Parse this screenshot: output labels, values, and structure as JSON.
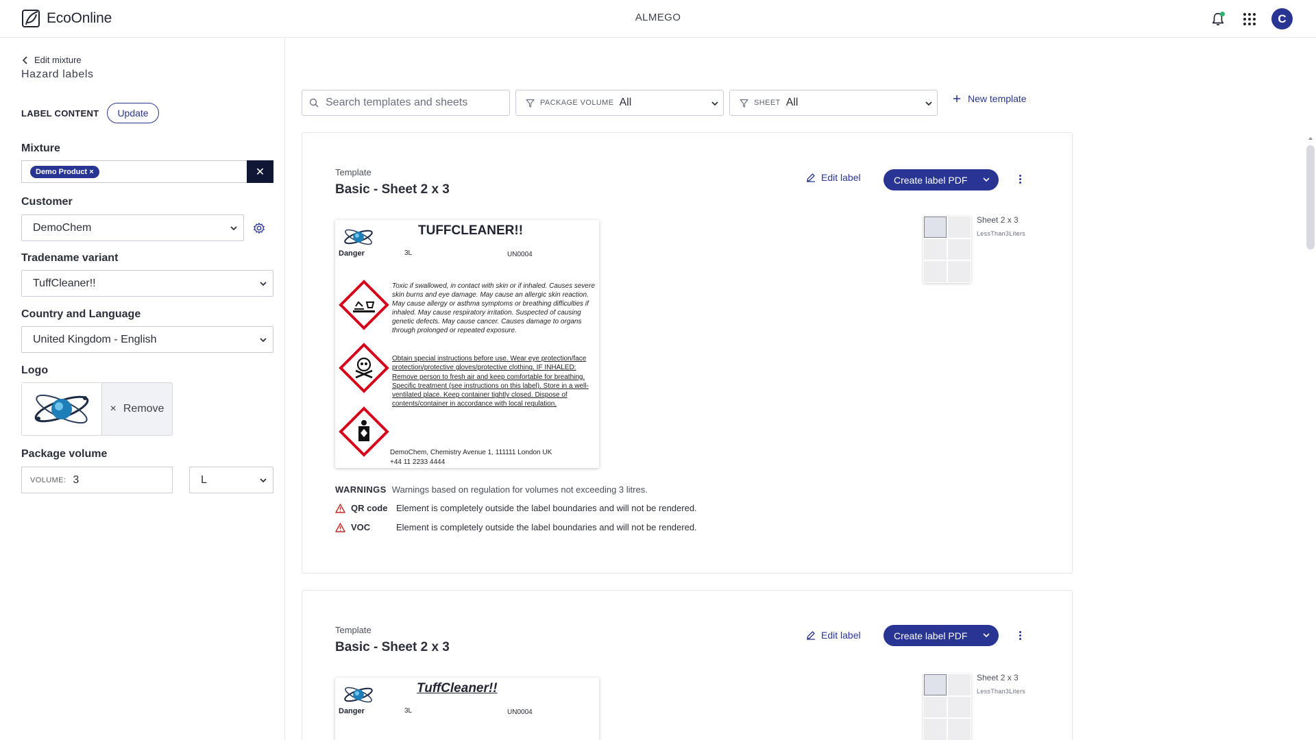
{
  "app": {
    "brand": "EcoOnline",
    "org": "ALMEGO",
    "avatar_initial": "C"
  },
  "left": {
    "back_link": "Edit mixture",
    "page_title": "Hazard labels",
    "label_content": "LABEL CONTENT",
    "update_button": "Update",
    "mixture": {
      "label": "Mixture",
      "chip": "Demo Product ×",
      "clear": "✕"
    },
    "customer": {
      "label": "Customer",
      "value": "DemoChem"
    },
    "tradename": {
      "label": "Tradename variant",
      "value": "TuffCleaner!!"
    },
    "country": {
      "label": "Country and Language",
      "value": "United Kingdom - English"
    },
    "logo": {
      "label": "Logo",
      "remove": "Remove",
      "remove_icon": "×"
    },
    "package": {
      "label": "Package volume",
      "prefix": "VOLUME:",
      "value": "3",
      "unit": "L"
    }
  },
  "toolbar": {
    "search_placeholder": "Search templates and sheets",
    "package_filter": {
      "key": "PACKAGE VOLUME",
      "value": "All"
    },
    "sheet_filter": {
      "key": "SHEET",
      "value": "All"
    },
    "new_template": "New template"
  },
  "cards": [
    {
      "kicker": "Template",
      "title": "Basic - Sheet 2 x 3",
      "edit_label": "Edit label",
      "create_pdf": "Create label PDF",
      "sheet_name": "Sheet 2 x 3",
      "sheet_sub": "LessThan3Liters",
      "label": {
        "product": "TUFFCLEANER!!",
        "signal": "Danger",
        "volume": "3L",
        "un": "UN0004",
        "hazards": "Toxic if swallowed, in contact with skin or if inhaled. Causes severe skin burns and eye damage. May cause an allergic skin reaction. May cause allergy or asthma symptoms or breathing difficulties if inhaled. May cause respiratory irritation. Suspected of causing genetic defects. May cause cancer. Causes damage to organs through prolonged or repeated exposure.",
        "precautions": "Obtain special instructions before use. Wear eye protection/face protection/protective gloves/protective clothing. IF INHALED: Remove person to fresh air and keep comfortable for breathing. Specific treatment (see instructions on this label). Store in a well-ventilated place. Keep container tightly closed. Dispose of contents/container in accordance with local regulation.",
        "address": "DemoChem, Chemistry Avenue 1, 111111 London UK",
        "phone": "+44 11 2233 4444"
      },
      "warnings": {
        "title": "WARNINGS",
        "desc": "Warnings based on regulation for volumes not exceeding 3 litres.",
        "items": [
          {
            "name": "QR code",
            "text": "Element is completely outside the label boundaries and will not be rendered."
          },
          {
            "name": "VOC",
            "text": "Element is completely outside the label boundaries and will not be rendered."
          }
        ]
      }
    },
    {
      "kicker": "Template",
      "title": "Basic - Sheet 2 x 3",
      "edit_label": "Edit label",
      "create_pdf": "Create label PDF",
      "sheet_name": "Sheet 2 x 3",
      "sheet_sub": "LessThan3Liters",
      "label": {
        "product": "TuffCleaner!!",
        "signal": "Danger",
        "volume": "3L",
        "un": "UN0004"
      }
    }
  ]
}
